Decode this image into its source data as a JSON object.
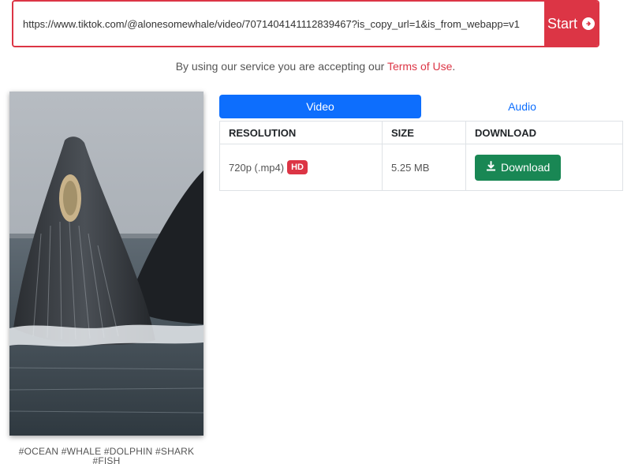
{
  "search": {
    "value": "https://www.tiktok.com/@alonesomewhale/video/7071404141112839467?is_copy_url=1&is_from_webapp=v1",
    "start_label": "Start",
    "start_icon": "arrow-circle-right-icon"
  },
  "terms": {
    "prefix": "By using our service you are accepting our ",
    "link": "Terms of Use",
    "suffix": "."
  },
  "video": {
    "tags": "#OCEAN #WHALE #DOLPHIN #SHARK #FISH"
  },
  "tabs": [
    {
      "label": "Video",
      "active": true
    },
    {
      "label": "Audio",
      "active": false
    }
  ],
  "table": {
    "headers": [
      "RESOLUTION",
      "SIZE",
      "DOWNLOAD"
    ],
    "rows": [
      {
        "resolution": "720p (.mp4)",
        "badge": "HD",
        "size": "5.25 MB",
        "download_label": "Download",
        "download_icon": "download-icon"
      }
    ]
  },
  "colors": {
    "accent_red": "#dc3545",
    "tab_blue": "#0d6efd",
    "download_green": "#198754"
  }
}
